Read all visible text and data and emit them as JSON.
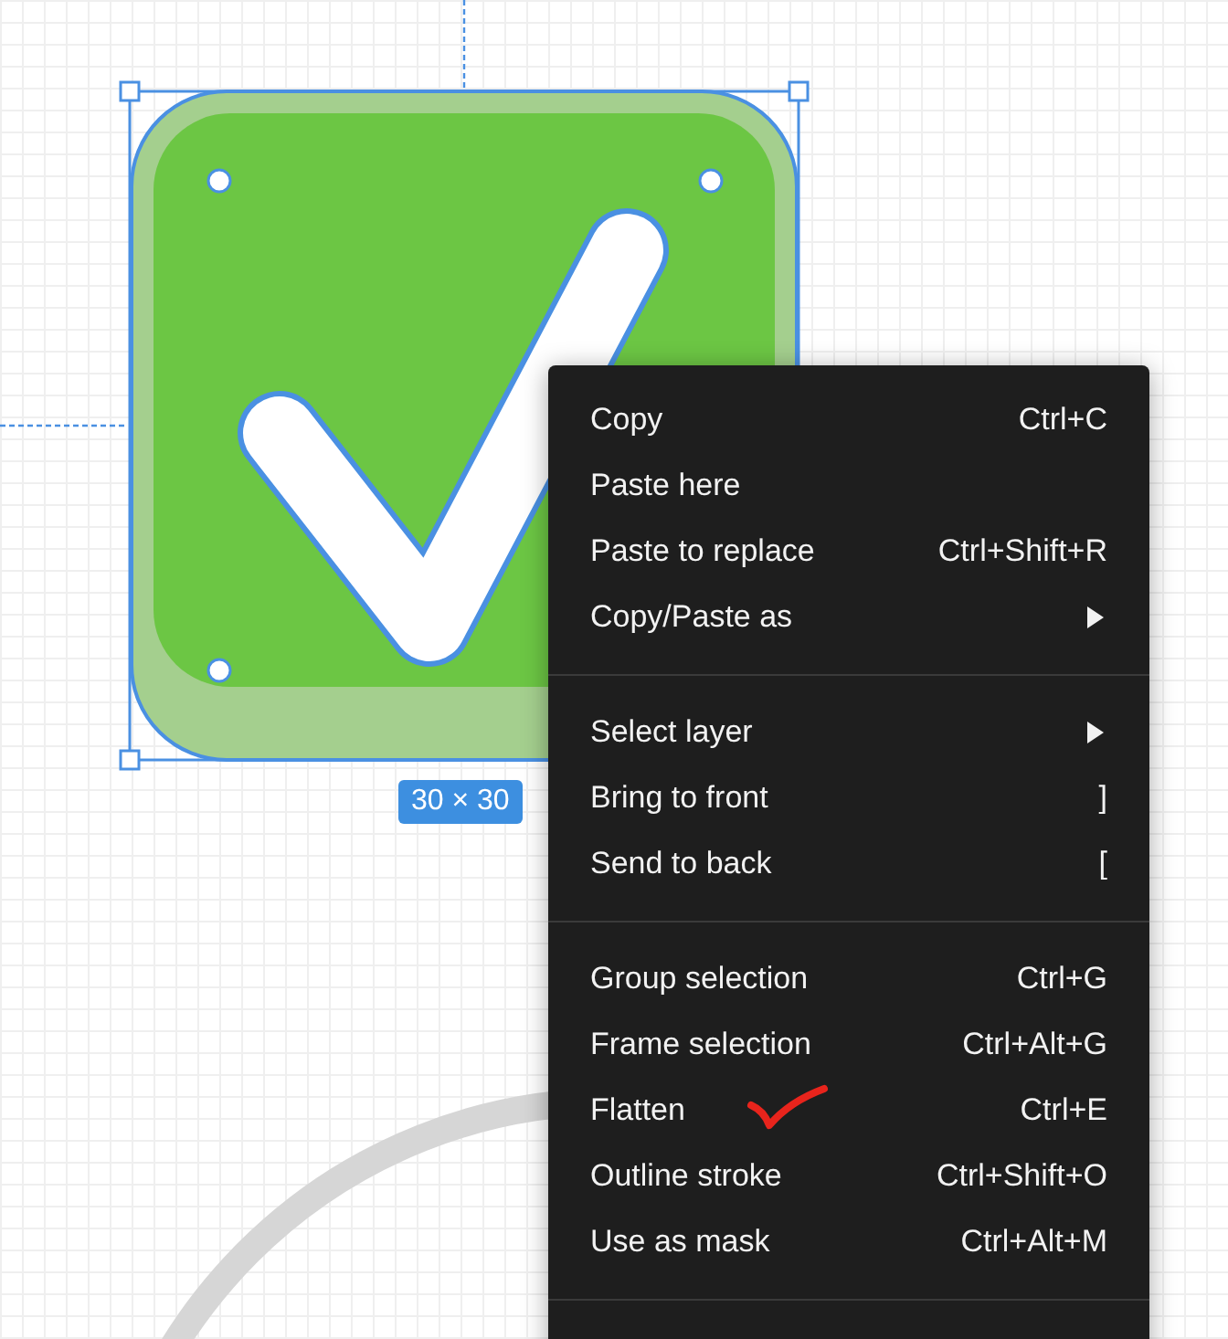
{
  "selection": {
    "size_label": "30 × 30"
  },
  "context_menu": {
    "groups": [
      {
        "items": [
          {
            "kind": "shortcut",
            "label": "Copy",
            "shortcut": "Ctrl+C"
          },
          {
            "kind": "plain",
            "label": "Paste here"
          },
          {
            "kind": "shortcut",
            "label": "Paste to replace",
            "shortcut": "Ctrl+Shift+R"
          },
          {
            "kind": "submenu",
            "label": "Copy/Paste as"
          }
        ]
      },
      {
        "items": [
          {
            "kind": "submenu",
            "label": "Select layer"
          },
          {
            "kind": "shortcut",
            "label": "Bring to front",
            "shortcut": "]"
          },
          {
            "kind": "shortcut",
            "label": "Send to back",
            "shortcut": "["
          }
        ]
      },
      {
        "items": [
          {
            "kind": "shortcut",
            "label": "Group selection",
            "shortcut": "Ctrl+G"
          },
          {
            "kind": "shortcut",
            "label": "Frame selection",
            "shortcut": "Ctrl+Alt+G"
          },
          {
            "kind": "shortcut",
            "label": "Flatten",
            "shortcut": "Ctrl+E"
          },
          {
            "kind": "shortcut",
            "label": "Outline stroke",
            "shortcut": "Ctrl+Shift+O"
          },
          {
            "kind": "shortcut",
            "label": "Use as mask",
            "shortcut": "Ctrl+Alt+M"
          }
        ]
      }
    ]
  }
}
